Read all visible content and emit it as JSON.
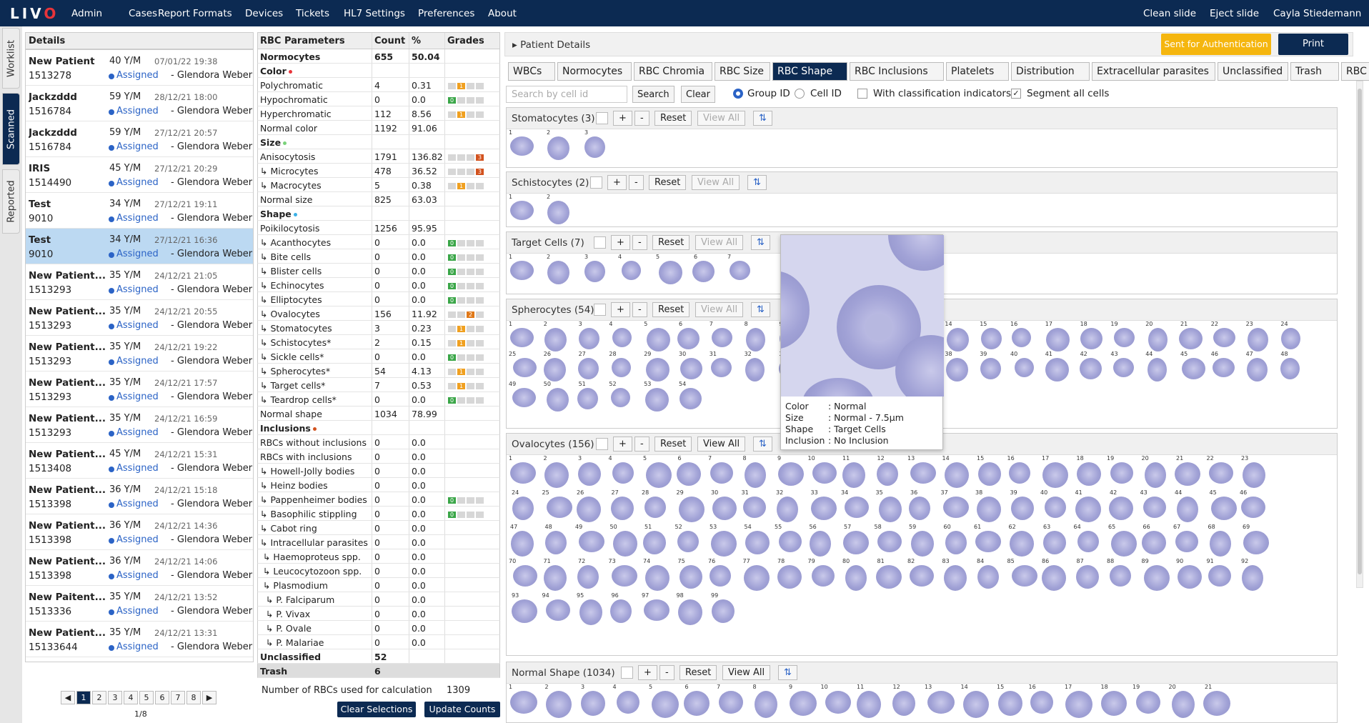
{
  "app": {
    "logo": "LIV",
    "logo_o": "O"
  },
  "nav": {
    "items": [
      "Admin",
      "Cases",
      "Report Formats",
      "Devices",
      "Tickets",
      "HL7 Settings",
      "Preferences",
      "About"
    ],
    "right": [
      "Clean slide",
      "Eject slide",
      "Cayla Stiedemann"
    ]
  },
  "sidetabs": [
    "Worklist",
    "Scanned",
    "Reported"
  ],
  "details": {
    "title": "Details",
    "cases": [
      {
        "name": "New Patient",
        "age": "40 Y/M",
        "date": "07/01/22 19:38",
        "id": "1513278",
        "status": "Assigned",
        "user": "- Glendora Weber"
      },
      {
        "name": "Jackzddd",
        "age": "59 Y/M",
        "date": "28/12/21 18:00",
        "id": "1516784",
        "status": "Assigned",
        "user": "- Glendora Weber"
      },
      {
        "name": "Jackzddd",
        "age": "59 Y/M",
        "date": "27/12/21 20:57",
        "id": "1516784",
        "status": "Assigned",
        "user": "- Glendora Weber"
      },
      {
        "name": "IRIS",
        "age": "45 Y/M",
        "date": "27/12/21 20:29",
        "id": "1514490",
        "status": "Assigned",
        "user": "- Glendora Weber"
      },
      {
        "name": "Test",
        "age": "34 Y/M",
        "date": "27/12/21 19:11",
        "id": "9010",
        "status": "Assigned",
        "user": "- Glendora Weber"
      },
      {
        "name": "Test",
        "age": "34 Y/M",
        "date": "27/12/21 16:36",
        "id": "9010",
        "status": "Assigned",
        "user": "- Glendora Weber",
        "selected": true
      },
      {
        "name": "New Patient...",
        "age": "35 Y/M",
        "date": "24/12/21 21:05",
        "id": "1513293",
        "status": "Assigned",
        "user": "- Glendora Weber"
      },
      {
        "name": "New Patient...",
        "age": "35 Y/M",
        "date": "24/12/21 20:55",
        "id": "1513293",
        "status": "Assigned",
        "user": "- Glendora Weber"
      },
      {
        "name": "New Patient...",
        "age": "35 Y/M",
        "date": "24/12/21 19:22",
        "id": "1513293",
        "status": "Assigned",
        "user": "- Glendora Weber"
      },
      {
        "name": "New Patient...",
        "age": "35 Y/M",
        "date": "24/12/21 17:57",
        "id": "1513293",
        "status": "Assigned",
        "user": "- Glendora Weber"
      },
      {
        "name": "New Patient...",
        "age": "35 Y/M",
        "date": "24/12/21 16:59",
        "id": "1513293",
        "status": "Assigned",
        "user": "- Glendora Weber"
      },
      {
        "name": "New Patient...",
        "age": "45 Y/M",
        "date": "24/12/21 15:31",
        "id": "1513408",
        "status": "Assigned",
        "user": "- Glendora Weber"
      },
      {
        "name": "New Patient...",
        "age": "36 Y/M",
        "date": "24/12/21 15:18",
        "id": "1513398",
        "status": "Assigned",
        "user": "- Glendora Weber"
      },
      {
        "name": "New Patient...",
        "age": "36 Y/M",
        "date": "24/12/21 14:36",
        "id": "1513398",
        "status": "Assigned",
        "user": "- Glendora Weber"
      },
      {
        "name": "New Patient...",
        "age": "36 Y/M",
        "date": "24/12/21 14:06",
        "id": "1513398",
        "status": "Assigned",
        "user": "- Glendora Weber"
      },
      {
        "name": "New Paitent...",
        "age": "35 Y/M",
        "date": "24/12/21 13:52",
        "id": "1513336",
        "status": "Assigned",
        "user": "- Glendora Weber"
      },
      {
        "name": "New Patient...",
        "age": "35 Y/M",
        "date": "24/12/21 13:31",
        "id": "15133644",
        "status": "Assigned",
        "user": "- Glendora Weber"
      }
    ],
    "pages": [
      "1",
      "2",
      "3",
      "4",
      "5",
      "6",
      "7",
      "8"
    ],
    "page_info": "1/8"
  },
  "rbc": {
    "headers": [
      "RBC Parameters",
      "Count",
      "%",
      "Grades"
    ],
    "rows": [
      {
        "name": "Normocytes",
        "count": "655",
        "pct": "50.04",
        "bold": true
      },
      {
        "name": "Color",
        "bold": true,
        "dot": "#e8343a"
      },
      {
        "name": "Polychromatic",
        "count": "4",
        "pct": "0.31",
        "grade": {
          "level": 1,
          "color": "#f0a020"
        }
      },
      {
        "name": "Hypochromatic",
        "count": "0",
        "pct": "0.0",
        "grade": {
          "level": 0,
          "color": "#3aa648"
        }
      },
      {
        "name": "Hyperchromatic",
        "count": "112",
        "pct": "8.56",
        "grade": {
          "level": 1,
          "color": "#f0a020"
        }
      },
      {
        "name": "Normal color",
        "count": "1192",
        "pct": "91.06"
      },
      {
        "name": "Size",
        "bold": true,
        "dot": "#7ad27a"
      },
      {
        "name": "Anisocytosis",
        "count": "1791",
        "pct": "136.82",
        "grade": {
          "level": 3,
          "color": "#d2521e"
        }
      },
      {
        "name": "↳ Microcytes",
        "count": "478",
        "pct": "36.52",
        "grade": {
          "level": 3,
          "color": "#d2521e"
        }
      },
      {
        "name": "↳ Macrocytes",
        "count": "5",
        "pct": "0.38",
        "grade": {
          "level": 1,
          "color": "#f0a020"
        }
      },
      {
        "name": "Normal size",
        "count": "825",
        "pct": "63.03"
      },
      {
        "name": "Shape",
        "bold": true,
        "dot": "#3ab0e6"
      },
      {
        "name": "Poikilocytosis",
        "count": "1256",
        "pct": "95.95"
      },
      {
        "name": "↳ Acanthocytes",
        "count": "0",
        "pct": "0.0",
        "grade": {
          "level": 0,
          "color": "#3aa648"
        }
      },
      {
        "name": "↳ Bite cells",
        "count": "0",
        "pct": "0.0",
        "grade": {
          "level": 0,
          "color": "#3aa648"
        }
      },
      {
        "name": "↳ Blister cells",
        "count": "0",
        "pct": "0.0",
        "grade": {
          "level": 0,
          "color": "#3aa648"
        }
      },
      {
        "name": "↳ Echinocytes",
        "count": "0",
        "pct": "0.0",
        "grade": {
          "level": 0,
          "color": "#3aa648"
        }
      },
      {
        "name": "↳ Elliptocytes",
        "count": "0",
        "pct": "0.0",
        "grade": {
          "level": 0,
          "color": "#3aa648"
        }
      },
      {
        "name": "↳ Ovalocytes",
        "count": "156",
        "pct": "11.92",
        "grade": {
          "level": 2,
          "color": "#e07818"
        }
      },
      {
        "name": "↳ Stomatocytes",
        "count": "3",
        "pct": "0.23",
        "grade": {
          "level": 1,
          "color": "#f0a020"
        }
      },
      {
        "name": "↳ Schistocytes*",
        "count": "2",
        "pct": "0.15",
        "grade": {
          "level": 1,
          "color": "#f0a020"
        }
      },
      {
        "name": "↳ Sickle cells*",
        "count": "0",
        "pct": "0.0",
        "grade": {
          "level": 0,
          "color": "#3aa648"
        }
      },
      {
        "name": "↳ Spherocytes*",
        "count": "54",
        "pct": "4.13",
        "grade": {
          "level": 1,
          "color": "#f0a020"
        }
      },
      {
        "name": "↳ Target cells*",
        "count": "7",
        "pct": "0.53",
        "grade": {
          "level": 1,
          "color": "#f0a020"
        }
      },
      {
        "name": "↳ Teardrop cells*",
        "count": "0",
        "pct": "0.0",
        "grade": {
          "level": 0,
          "color": "#3aa648"
        }
      },
      {
        "name": "Normal shape",
        "count": "1034",
        "pct": "78.99"
      },
      {
        "name": "Inclusions",
        "bold": true,
        "dot": "#d2521e"
      },
      {
        "name": "RBCs without inclusions",
        "count": "0",
        "pct": "0.0"
      },
      {
        "name": "RBCs with inclusions",
        "count": "0",
        "pct": "0.0"
      },
      {
        "name": "↳ Howell-Jolly bodies",
        "count": "0",
        "pct": "0.0"
      },
      {
        "name": "↳ Heinz bodies",
        "count": "0",
        "pct": "0.0"
      },
      {
        "name": "↳ Pappenheimer bodies",
        "count": "0",
        "pct": "0.0",
        "grade": {
          "level": 0,
          "color": "#3aa648"
        }
      },
      {
        "name": "↳ Basophilic stippling",
        "count": "0",
        "pct": "0.0",
        "grade": {
          "level": 0,
          "color": "#3aa648"
        }
      },
      {
        "name": "↳ Cabot ring",
        "count": "0",
        "pct": "0.0"
      },
      {
        "name": "↳ Intracellular parasites",
        "count": "0",
        "pct": "0.0"
      },
      {
        "name": " ↳ Haemoproteus spp.",
        "count": "0",
        "pct": "0.0"
      },
      {
        "name": " ↳ Leucocytozoon spp.",
        "count": "0",
        "pct": "0.0"
      },
      {
        "name": " ↳ Plasmodium",
        "count": "0",
        "pct": "0.0"
      },
      {
        "name": "  ↳ P. Falciparum",
        "count": "0",
        "pct": "0.0"
      },
      {
        "name": "  ↳ P. Vivax",
        "count": "0",
        "pct": "0.0"
      },
      {
        "name": "  ↳ P. Ovale",
        "count": "0",
        "pct": "0.0"
      },
      {
        "name": "  ↳ P. Malariae",
        "count": "0",
        "pct": "0.0"
      },
      {
        "name": "Unclassified",
        "count": "52",
        "pct": "",
        "bold": true
      },
      {
        "name": "Trash",
        "count": "6",
        "pct": "",
        "bold": true,
        "shade": true
      }
    ],
    "calc_label": "Number of RBCs used for calculation",
    "calc_value": "1309",
    "btn_clear": "Clear Selections",
    "btn_update": "Update Counts"
  },
  "patient": {
    "title": "Patient Details",
    "status_btn": "Sent for Authentication",
    "print": "Print",
    "status_color": "#f5b60f"
  },
  "tabs": [
    "WBCs",
    "Normocytes",
    "RBC Chromia",
    "RBC Size",
    "RBC Shape",
    "RBC Inclusions",
    "Platelets",
    "Distribution",
    "Extracellular parasites",
    "Unclassified",
    "Trash",
    "RBC View"
  ],
  "active_tab": "RBC Shape",
  "toolbar": {
    "search_placeholder": "Search by cell id",
    "search": "Search",
    "clear": "Clear",
    "group_id": "Group ID",
    "cell_id": "Cell ID",
    "with_indicators": "With classification indicators",
    "segment_all": "Segment all cells"
  },
  "group_btns": {
    "plus": "+",
    "minus": "-",
    "reset": "Reset",
    "view_all": "View All"
  },
  "groups": [
    {
      "title": "Stomatocytes (3)",
      "count": 3
    },
    {
      "title": "Schistocytes (2)",
      "count": 2
    },
    {
      "title": "Target Cells (7)",
      "count": 7
    },
    {
      "title": "Spherocytes (54)",
      "count": 54
    },
    {
      "title": "Ovalocytes (156)",
      "count": 99
    },
    {
      "title": "Normal Shape (1034)",
      "count": 21
    }
  ],
  "popup": {
    "rows": [
      {
        "k": "Color",
        "v": ": Normal"
      },
      {
        "k": "Size",
        "v": ": Normal - 7.5μm"
      },
      {
        "k": "Shape",
        "v": ": Target Cells"
      },
      {
        "k": "Inclusion",
        "v": ": No Inclusion"
      }
    ]
  }
}
